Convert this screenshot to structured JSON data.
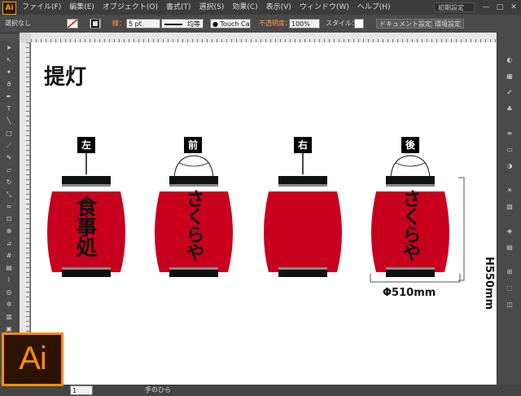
{
  "app": {
    "logo": "Ai",
    "workspace": "初期設定",
    "window_controls": [
      "—",
      "□",
      "✕"
    ]
  },
  "menu": [
    "ファイル(F)",
    "編集(E)",
    "オブジェクト(O)",
    "書式(T)",
    "選択(S)",
    "効果(C)",
    "表示(V)",
    "ウィンドウ(W)",
    "ヘルプ(H)"
  ],
  "control_bar": {
    "selection": "選択なし",
    "stroke_label": "線：",
    "stroke_value": "5 pt",
    "stroke_profile": "均等",
    "brush": "Touch Ca...",
    "opacity_label": "不透明度：",
    "opacity_value": "100%",
    "style_label": "スタイル：",
    "doc_setup_button": "ドキュメント設定",
    "prefs_button": "環境設定"
  },
  "document": {
    "title": "提灯",
    "labels": [
      "左",
      "前",
      "右",
      "後"
    ],
    "lantern_texts": [
      "食事処",
      "さくらや",
      "",
      "さくらや"
    ],
    "dim_height": "H550mm",
    "dim_width": "Φ510mm"
  },
  "status": {
    "zoom": "",
    "page": "1",
    "tool": "手のひら"
  },
  "colors": {
    "lantern": "#c8001e",
    "band": "#111111",
    "accent": "#ff8b00"
  },
  "icons": [
    "selection-tool-icon",
    "direct-selection-icon",
    "magic-wand-icon",
    "lasso-icon",
    "pen-tool-icon",
    "type-tool-icon",
    "line-tool-icon",
    "rectangle-tool-icon",
    "paintbrush-icon",
    "pencil-icon",
    "eraser-icon",
    "rotate-icon",
    "scale-icon",
    "warp-icon",
    "free-transform-icon",
    "shape-builder-icon",
    "perspective-icon",
    "mesh-icon",
    "gradient-icon",
    "eyedropper-icon",
    "blend-icon",
    "symbol-sprayer-icon",
    "graph-icon",
    "artboard-icon",
    "slice-icon",
    "hand-icon",
    "zoom-icon"
  ]
}
